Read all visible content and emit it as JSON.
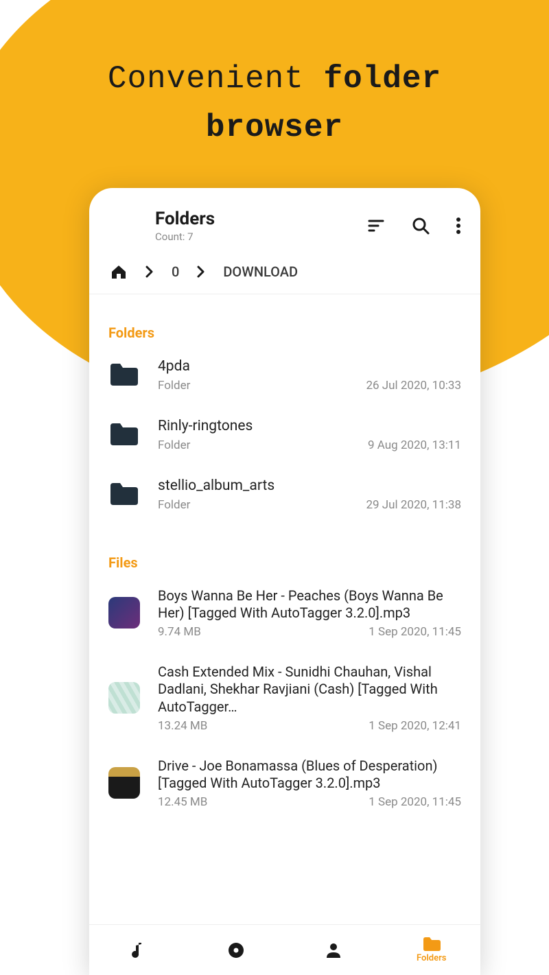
{
  "promo": {
    "line1": "Convenient",
    "line2a": "folder",
    "line2b": "browser"
  },
  "header": {
    "title": "Folders",
    "count_label": "Count: 7"
  },
  "breadcrumb": {
    "segment1": "0",
    "segment2": "DOWNLOAD"
  },
  "sections": {
    "folders_label": "Folders",
    "files_label": "Files"
  },
  "folders": [
    {
      "name": "4pda",
      "type": "Folder",
      "date": "26 Jul 2020, 10:33"
    },
    {
      "name": "Rinly-ringtones",
      "type": "Folder",
      "date": "9 Aug 2020, 13:11"
    },
    {
      "name": "stellio_album_arts",
      "type": "Folder",
      "date": "29 Jul 2020, 11:38"
    }
  ],
  "files": [
    {
      "name": "Boys Wanna Be Her - Peaches (Boys Wanna Be Her) [Tagged With AutoTagger 3.2.0].mp3",
      "size": "9.74 MB",
      "date": "1 Sep 2020, 11:45",
      "thumb": "t1"
    },
    {
      "name": "Cash Extended Mix - Sunidhi Chauhan, Vishal Dadlani, Shekhar Ravjiani (Cash) [Tagged With AutoTagger…",
      "size": "13.24 MB",
      "date": "1 Sep 2020, 12:41",
      "thumb": "t2"
    },
    {
      "name": "Drive - Joe Bonamassa (Blues of Desperation) [Tagged With AutoTagger 3.2.0].mp3",
      "size": "12.45 MB",
      "date": "1 Sep 2020, 11:45",
      "thumb": "t3"
    }
  ],
  "bottom_nav": {
    "songs": "",
    "albums": "",
    "artists": "",
    "folders": "Folders"
  }
}
